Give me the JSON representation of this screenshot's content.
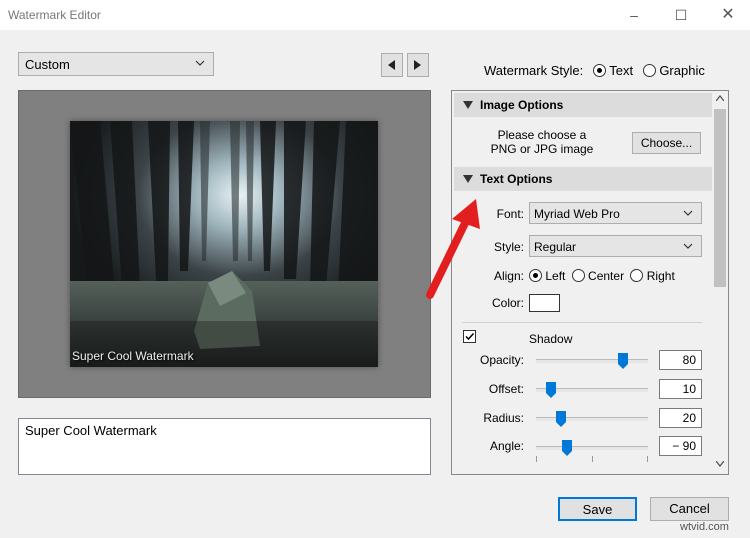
{
  "window": {
    "title": "Watermark Editor"
  },
  "preset": {
    "value": "Custom"
  },
  "preview": {
    "watermark_text": "Super Cool Watermark"
  },
  "text_input": {
    "value": "Super Cool Watermark"
  },
  "watermark_style": {
    "label": "Watermark Style:",
    "options": [
      "Text",
      "Graphic"
    ],
    "selected": "Text"
  },
  "image_options": {
    "title": "Image Options",
    "prompt_line1": "Please choose a",
    "prompt_line2": "PNG or JPG image",
    "choose_label": "Choose..."
  },
  "text_options": {
    "title": "Text Options",
    "font_label": "Font:",
    "font_value": "Myriad Web Pro",
    "style_label": "Style:",
    "style_value": "Regular",
    "align_label": "Align:",
    "align_options": [
      "Left",
      "Center",
      "Right"
    ],
    "align_selected": "Left",
    "color_label": "Color:",
    "color_value": "#ffffff"
  },
  "shadow": {
    "label": "Shadow",
    "enabled": true,
    "opacity": {
      "label": "Opacity:",
      "value": "80",
      "fraction": 0.8
    },
    "offset": {
      "label": "Offset:",
      "value": "10",
      "fraction": 0.1
    },
    "radius": {
      "label": "Radius:",
      "value": "20",
      "fraction": 0.2
    },
    "angle": {
      "label": "Angle:",
      "value": "− 90",
      "fraction": 0.25
    }
  },
  "buttons": {
    "save": "Save",
    "cancel": "Cancel"
  },
  "site_watermark": "wtvid.com",
  "colors": {
    "accent": "#0078d7",
    "annotation_arrow": "#e21e1e"
  },
  "icons": [
    "minimize-icon",
    "maximize-icon",
    "close-icon",
    "chevron-down-icon",
    "previous-icon",
    "next-icon",
    "collapse-triangle-icon",
    "checkbox-icon",
    "slider-thumb-icon",
    "scroll-down-icon",
    "scroll-up-icon"
  ]
}
